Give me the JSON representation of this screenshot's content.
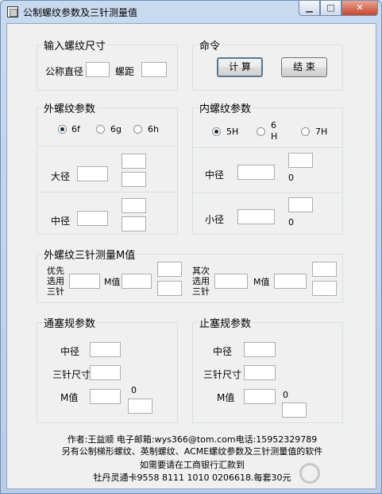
{
  "window": {
    "title": "公制螺纹参数及三针测量值"
  },
  "input_group": {
    "title": "输入螺纹尺寸",
    "diameter_label": "公称直径",
    "pitch_label": "螺距"
  },
  "command_group": {
    "title": "命令",
    "calc_label": "计 算",
    "exit_label": "结 束"
  },
  "external_group": {
    "title": "外螺纹参数",
    "radio_6f": "6f",
    "radio_6g": "6g",
    "radio_6h": "6h",
    "major_label": "大径",
    "pitch_dia_label": "中径"
  },
  "internal_group": {
    "title": "内螺纹参数",
    "radio_5h": "5H",
    "radio_6h_top": "6",
    "radio_6h_bottom": "H",
    "radio_7h": "7H",
    "pitch_dia_label": "中径",
    "minor_label": "小径",
    "pitch_dia_value": "0",
    "minor_value": "0"
  },
  "three_wire_group": {
    "title": "外螺纹三针测量M值",
    "pref_line1": "优先",
    "pref_line2": "选用",
    "pref_line3": "三针",
    "m_label1": "M值",
    "sec_line1": "其次",
    "sec_line2": "选用",
    "sec_line3": "三针",
    "m_label2": "M值"
  },
  "go_gauge_group": {
    "title": "通塞规参数",
    "pitch_dia_label": "中径",
    "wire_label": "三针尺寸",
    "m_label": "M值",
    "m_value": "0"
  },
  "nogo_gauge_group": {
    "title": "止塞规参数",
    "pitch_dia_label": "中径",
    "wire_label": "三针尺寸",
    "m_label": "M值",
    "m_value": "0"
  },
  "footer": {
    "line1": "作者:王益顺 电子邮箱:wys366@tom.com电话:15952329789",
    "line2": "另有公制梯形螺纹、英制螺纹、ACME螺纹参数及三针测量值的软件",
    "line3": "如需要请在工商银行汇款到",
    "line4": "牡丹灵通卡9558 8111 1010 0206618.每套30元"
  },
  "selected": {
    "external_tolerance": "6f",
    "internal_tolerance": "5H"
  }
}
